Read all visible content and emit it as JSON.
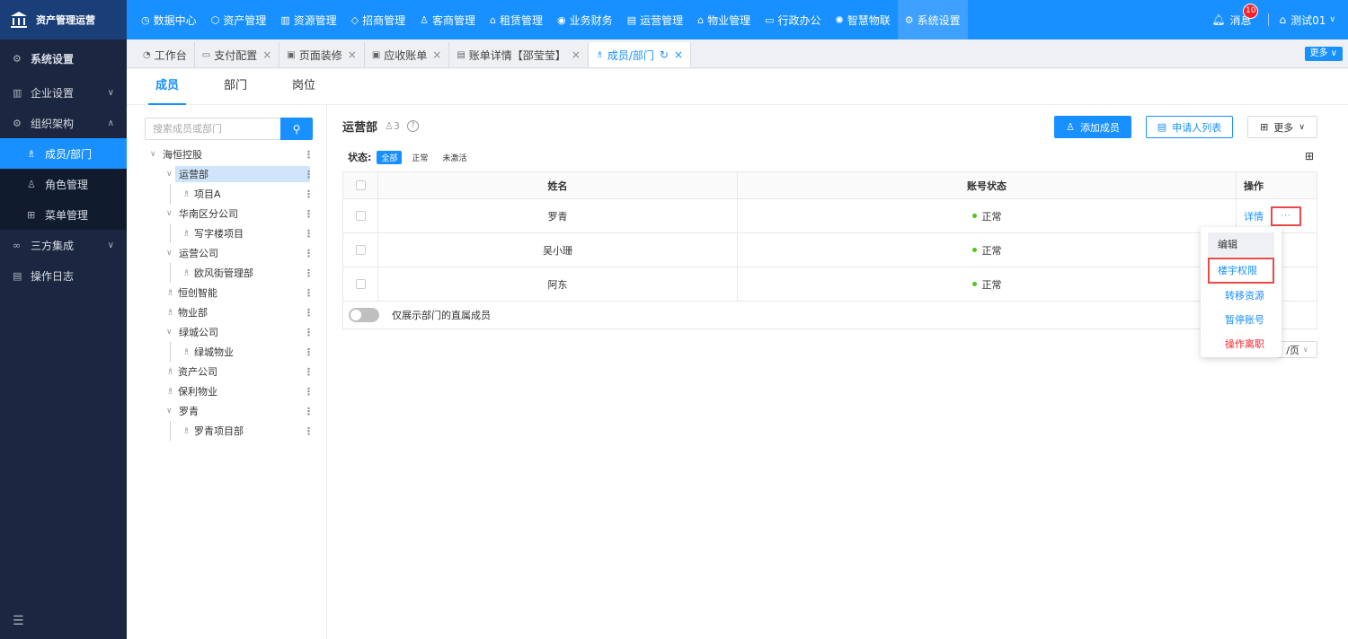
{
  "app": {
    "name": "资产管理运营"
  },
  "topnav": [
    {
      "label": "数据中心",
      "icon": "clock-icon"
    },
    {
      "label": "资产管理",
      "icon": "cube-icon"
    },
    {
      "label": "资源管理",
      "icon": "building-icon"
    },
    {
      "label": "招商管理",
      "icon": "tag-icon"
    },
    {
      "label": "客商管理",
      "icon": "users-icon"
    },
    {
      "label": "租赁管理",
      "icon": "house-icon"
    },
    {
      "label": "业务财务",
      "icon": "coin-icon"
    },
    {
      "label": "运营管理",
      "icon": "chart-icon"
    },
    {
      "label": "物业管理",
      "icon": "home-icon"
    },
    {
      "label": "行政办公",
      "icon": "monitor-icon"
    },
    {
      "label": "智慧物联",
      "icon": "sun-icon"
    },
    {
      "label": "系统设置",
      "icon": "gear-icon",
      "active": true
    }
  ],
  "header_right": {
    "message_label": "消息",
    "message_count": "10",
    "user_name": "测试01"
  },
  "sidebar": {
    "title": "系统设置",
    "items": [
      {
        "label": "企业设置",
        "icon": "building-icon",
        "arrow": "∨"
      },
      {
        "label": "组织架构",
        "icon": "org-icon",
        "arrow": "∧"
      },
      {
        "label": "成员/部门",
        "icon": "tree-icon",
        "sub": true,
        "selected": true
      },
      {
        "label": "角色管理",
        "icon": "user-role-icon",
        "sub": true
      },
      {
        "label": "菜单管理",
        "icon": "grid-icon",
        "sub": true
      },
      {
        "label": "三方集成",
        "icon": "link-icon",
        "arrow": "∨"
      },
      {
        "label": "操作日志",
        "icon": "log-icon"
      }
    ]
  },
  "tabs": [
    {
      "label": "工作台",
      "icon": "dashboard-icon",
      "closable": false
    },
    {
      "label": "支付配置",
      "icon": "card-icon",
      "closable": true
    },
    {
      "label": "页面装修",
      "icon": "layout-icon",
      "closable": true
    },
    {
      "label": "应收账单",
      "icon": "bill-icon",
      "closable": true
    },
    {
      "label": "账单详情【邵莹莹】",
      "icon": "doc-icon",
      "closable": true
    },
    {
      "label": "成员/部门",
      "icon": "tree-icon",
      "closable": true,
      "active": true
    }
  ],
  "tabs_more": "更多",
  "subtabs": [
    {
      "label": "成员",
      "active": true
    },
    {
      "label": "部门"
    },
    {
      "label": "岗位"
    }
  ],
  "search": {
    "placeholder": "搜索成员或部门"
  },
  "tree": [
    {
      "label": "海恒控股",
      "level": 0,
      "caret": true
    },
    {
      "label": "运营部",
      "level": 1,
      "caret": true,
      "highlight": true
    },
    {
      "label": "项目A",
      "level": 2,
      "icon": true
    },
    {
      "label": "华南区分公司",
      "level": 1,
      "caret": true
    },
    {
      "label": "写字楼项目",
      "level": 2,
      "icon": true
    },
    {
      "label": "运营公司",
      "level": 1,
      "caret": true
    },
    {
      "label": "欧风街管理部",
      "level": 2,
      "icon": true
    },
    {
      "label": "恒创智能",
      "level": 1,
      "icon": true
    },
    {
      "label": "物业部",
      "level": 1,
      "icon": true
    },
    {
      "label": "绿城公司",
      "level": 1,
      "caret": true
    },
    {
      "label": "绿城物业",
      "level": 2,
      "icon": true
    },
    {
      "label": "资产公司",
      "level": 1,
      "icon": true
    },
    {
      "label": "保利物业",
      "level": 1,
      "icon": true
    },
    {
      "label": "罗青",
      "level": 1,
      "caret": true
    },
    {
      "label": "罗青项目部",
      "level": 2,
      "icon": true
    }
  ],
  "main": {
    "dept_name": "运营部",
    "member_count": "3",
    "add_member": "添加成员",
    "applicant_list": "申请人列表",
    "more": "更多",
    "status_label": "状态:",
    "status_filters": [
      {
        "label": "全部",
        "active": true
      },
      {
        "label": "正常"
      },
      {
        "label": "未激活"
      }
    ],
    "columns": [
      "姓名",
      "账号状态",
      "操作"
    ],
    "rows": [
      {
        "name": "罗青",
        "status": "正常",
        "detail": "详情",
        "menu": "···"
      },
      {
        "name": "吴小珊",
        "status": "正常"
      },
      {
        "name": "阿东",
        "status": "正常"
      }
    ],
    "toggle_label": "仅展示部门的直属成员",
    "pager_text": "/页"
  },
  "dropdown": [
    "编辑",
    "楼宇权限",
    "转移资源",
    "暂停账号",
    "操作离职"
  ],
  "colors": {
    "primary": "#1890ff",
    "sidebar_bg": "#1b2740",
    "danger": "#f5222d",
    "success": "#52c41a"
  }
}
